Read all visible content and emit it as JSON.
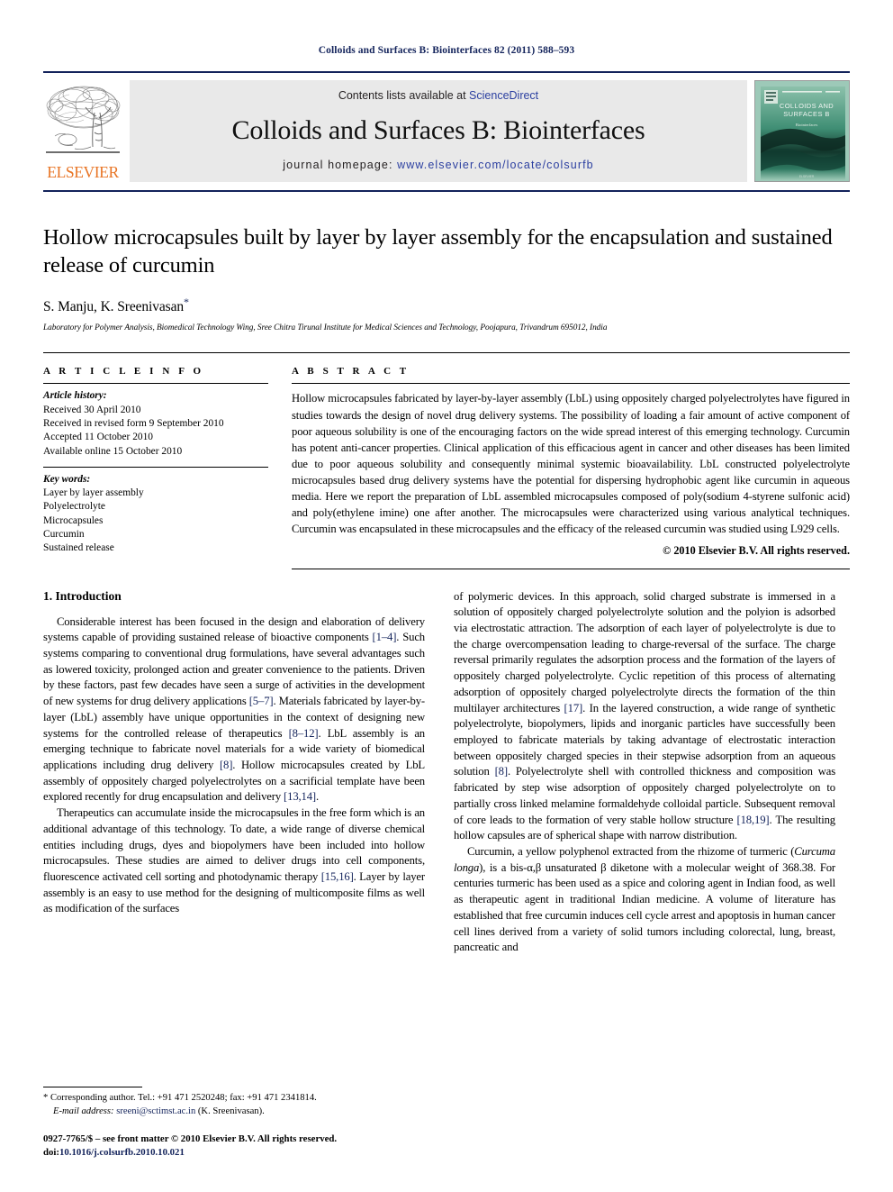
{
  "running_head": "Colloids and Surfaces B: Biointerfaces 82 (2011) 588–593",
  "masthead": {
    "publisher_name": "ELSEVIER",
    "contents_prefix": "Contents lists available at ",
    "sciencedirect_label": "ScienceDirect",
    "journal_title": "Colloids and Surfaces B: Biointerfaces",
    "homepage_prefix": "journal homepage: ",
    "homepage_url": "www.elsevier.com/locate/colsurfb",
    "cover_title_line1": "COLLOIDS AND",
    "cover_title_line2": "SURFACES B",
    "cover_subtitle": "Biointerfaces",
    "accent_color": "#13235b",
    "link_color": "#2b3fa0",
    "elsevier_orange": "#e87424"
  },
  "article": {
    "title": "Hollow microcapsules built by layer by layer assembly for the encapsulation and sustained release of curcumin",
    "authors": "S. Manju, K. Sreenivasan",
    "corresponding_marker": "*",
    "affiliation": "Laboratory for Polymer Analysis, Biomedical Technology Wing, Sree Chitra Tirunal Institute for Medical Sciences and Technology, Poojapura, Trivandrum 695012, India"
  },
  "article_info": {
    "heading": "A R T I C L E   I N F O",
    "history_label": "Article history:",
    "history": [
      "Received 30 April 2010",
      "Received in revised form 9 September 2010",
      "Accepted 11 October 2010",
      "Available online 15 October 2010"
    ],
    "keywords_label": "Key words:",
    "keywords": [
      "Layer by layer assembly",
      "Polyelectrolyte",
      "Microcapsules",
      "Curcumin",
      "Sustained release"
    ]
  },
  "abstract": {
    "heading": "A B S T R A C T",
    "text": "Hollow microcapsules fabricated by layer-by-layer assembly (LbL) using oppositely charged polyelectrolytes have figured in studies towards the design of novel drug delivery systems. The possibility of loading a fair amount of active component of poor aqueous solubility is one of the encouraging factors on the wide spread interest of this emerging technology. Curcumin has potent anti-cancer properties. Clinical application of this efficacious agent in cancer and other diseases has been limited due to poor aqueous solubility and consequently minimal systemic bioavailability. LbL constructed polyelectrolyte microcapsules based drug delivery systems have the potential for dispersing hydrophobic agent like curcumin in aqueous media. Here we report the preparation of LbL assembled microcapsules composed of poly(sodium 4-styrene sulfonic acid) and poly(ethylene imine) one after another. The microcapsules were characterized using various analytical techniques. Curcumin was encapsulated in these microcapsules and the efficacy of the released curcumin was studied using L929 cells.",
    "copyright": "© 2010 Elsevier B.V. All rights reserved."
  },
  "body": {
    "section_heading": "1. Introduction",
    "left_paragraphs": [
      "Considerable interest has been focused in the design and elaboration of delivery systems capable of providing sustained release of bioactive components [1–4]. Such systems comparing to conventional drug formulations, have several advantages such as lowered toxicity, prolonged action and greater convenience to the patients. Driven by these factors, past few decades have seen a surge of activities in the development of new systems for drug delivery applications [5–7]. Materials fabricated by layer-by-layer (LbL) assembly have unique opportunities in the context of designing new systems for the controlled release of therapeutics [8–12]. LbL assembly is an emerging technique to fabricate novel materials for a wide variety of biomedical applications including drug delivery [8]. Hollow microcapsules created by LbL assembly of oppositely charged polyelectrolytes on a sacrificial template have been explored recently for drug encapsulation and delivery [13,14].",
      "Therapeutics can accumulate inside the microcapsules in the free form which is an additional advantage of this technology. To date, a wide range of diverse chemical entities including drugs, dyes and biopolymers have been included into hollow microcapsules. These studies are aimed to deliver drugs into cell components, fluorescence activated cell sorting and photodynamic therapy [15,16]. Layer by layer assembly is an easy to use method for the designing of multicomposite films as well as modification of the surfaces"
    ],
    "right_paragraphs": [
      "of polymeric devices. In this approach, solid charged substrate is immersed in a solution of oppositely charged polyelectrolyte solution and the polyion is adsorbed via electrostatic attraction. The adsorption of each layer of polyelectrolyte is due to the charge overcompensation leading to charge-reversal of the surface. The charge reversal primarily regulates the adsorption process and the formation of the layers of oppositely charged polyelectrolyte. Cyclic repetition of this process of alternating adsorption of oppositely charged polyelectrolyte directs the formation of the thin multilayer architectures [17]. In the layered construction, a wide range of synthetic polyelectrolyte, biopolymers, lipids and inorganic particles have successfully been employed to fabricate materials by taking advantage of electrostatic interaction between oppositely charged species in their stepwise adsorption from an aqueous solution [8]. Polyelectrolyte shell with controlled thickness and composition was fabricated by step wise adsorption of oppositely charged polyelectrolyte on to partially cross linked melamine formaldehyde colloidal particle. Subsequent removal of core leads to the formation of very stable hollow structure [18,19]. The resulting hollow capsules are of spherical shape with narrow distribution.",
      "Curcumin, a yellow polyphenol extracted from the rhizome of turmeric (Curcuma longa), is a bis-α,β unsaturated β diketone with a molecular weight of 368.38. For centuries turmeric has been used as a spice and coloring agent in Indian food, as well as therapeutic agent in traditional Indian medicine. A volume of literature has established that free curcumin induces cell cycle arrest and apoptosis in human cancer cell lines derived from a variety of solid tumors including colorectal, lung, breast, pancreatic and"
    ]
  },
  "footnote": {
    "corresponding": "* Corresponding author. Tel.: +91 471 2520248; fax: +91 471 2341814.",
    "email_label": "E-mail address:",
    "email": "sreeni@sctimst.ac.in",
    "email_owner": "(K. Sreenivasan).",
    "issn_line": "0927-7765/$ – see front matter © 2010 Elsevier B.V. All rights reserved.",
    "doi_label": "doi:",
    "doi_value": "10.1016/j.colsurfb.2010.10.021"
  }
}
